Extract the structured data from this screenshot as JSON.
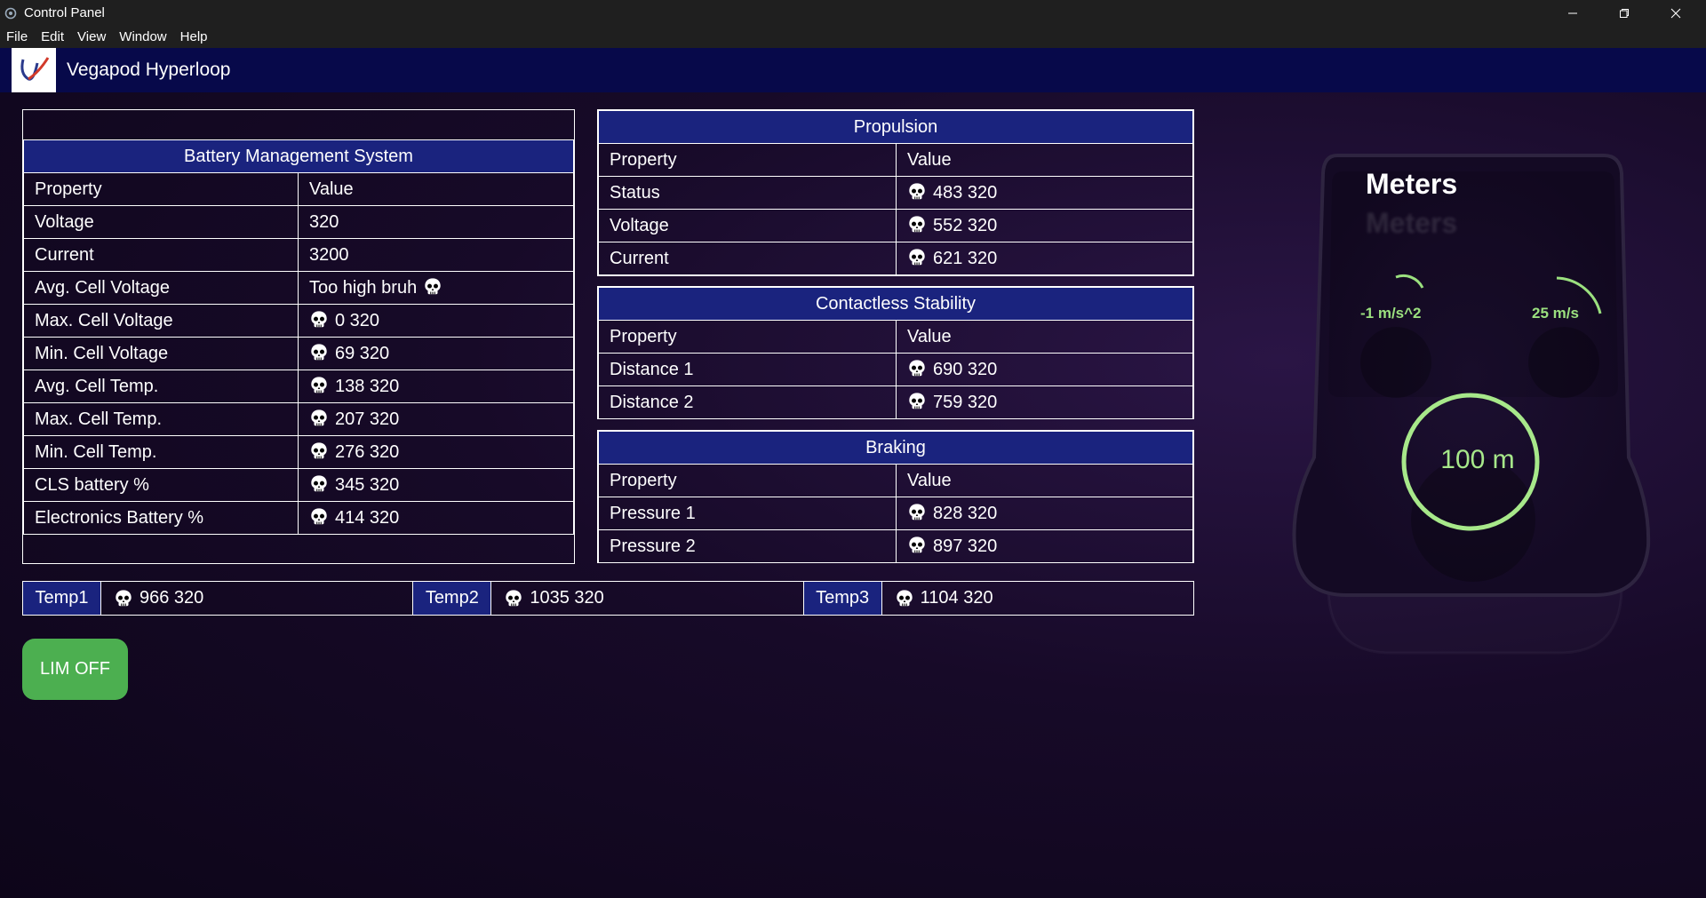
{
  "window": {
    "title": "Control Panel",
    "controls": [
      "minimize-icon",
      "restore-icon",
      "close-icon"
    ]
  },
  "menu": [
    "File",
    "Edit",
    "View",
    "Window",
    "Help"
  ],
  "header": {
    "brand": "Vegapod Hyperloop"
  },
  "bms": {
    "title": "Battery Management System",
    "col_property": "Property",
    "col_value": "Value",
    "rows": [
      {
        "property": "Voltage",
        "value": "320",
        "icon": ""
      },
      {
        "property": "Current",
        "value": "3200",
        "icon": ""
      },
      {
        "property": "Avg. Cell Voltage",
        "value": "Too high bruh",
        "icon": "skull-icon-after"
      },
      {
        "property": "Max. Cell Voltage",
        "value": "0 320",
        "icon": "skull-icon"
      },
      {
        "property": "Min. Cell Voltage",
        "value": "69 320",
        "icon": "skull-icon"
      },
      {
        "property": "Avg. Cell Temp.",
        "value": "138 320",
        "icon": "skull-icon"
      },
      {
        "property": "Max. Cell Temp.",
        "value": "207 320",
        "icon": "skull-icon"
      },
      {
        "property": "Min. Cell Temp.",
        "value": "276 320",
        "icon": "skull-icon"
      },
      {
        "property": "CLS battery %",
        "value": "345 320",
        "icon": "skull-icon"
      },
      {
        "property": "Electronics Battery %",
        "value": "414 320",
        "icon": "skull-icon"
      }
    ]
  },
  "propulsion": {
    "title": "Propulsion",
    "col_property": "Property",
    "col_value": "Value",
    "rows": [
      {
        "property": "Status",
        "value": "483 320"
      },
      {
        "property": "Voltage",
        "value": "552 320"
      },
      {
        "property": "Current",
        "value": "621 320"
      }
    ]
  },
  "stability": {
    "title": "Contactless Stability",
    "col_property": "Property",
    "col_value": "Value",
    "rows": [
      {
        "property": "Distance 1",
        "value": "690 320"
      },
      {
        "property": "Distance 2",
        "value": "759 320"
      }
    ]
  },
  "braking": {
    "title": "Braking",
    "col_property": "Property",
    "col_value": "Value",
    "rows": [
      {
        "property": "Pressure 1",
        "value": "828 320"
      },
      {
        "property": "Pressure 2",
        "value": "897 320"
      }
    ]
  },
  "temps": [
    {
      "label": "Temp1",
      "value": "966 320"
    },
    {
      "label": "Temp2",
      "value": "1035 320"
    },
    {
      "label": "Temp3",
      "value": "1104 320"
    }
  ],
  "lim_button": "LIM OFF",
  "meters": {
    "title": "Meters",
    "acceleration": "-1 m/s^2",
    "speed": "25 m/s",
    "distance": "100 m"
  },
  "colors": {
    "accent_blue": "#1a237e",
    "header_bg": "#07094a",
    "lim_green": "#4caf50",
    "meter_green": "#a7e88a"
  }
}
